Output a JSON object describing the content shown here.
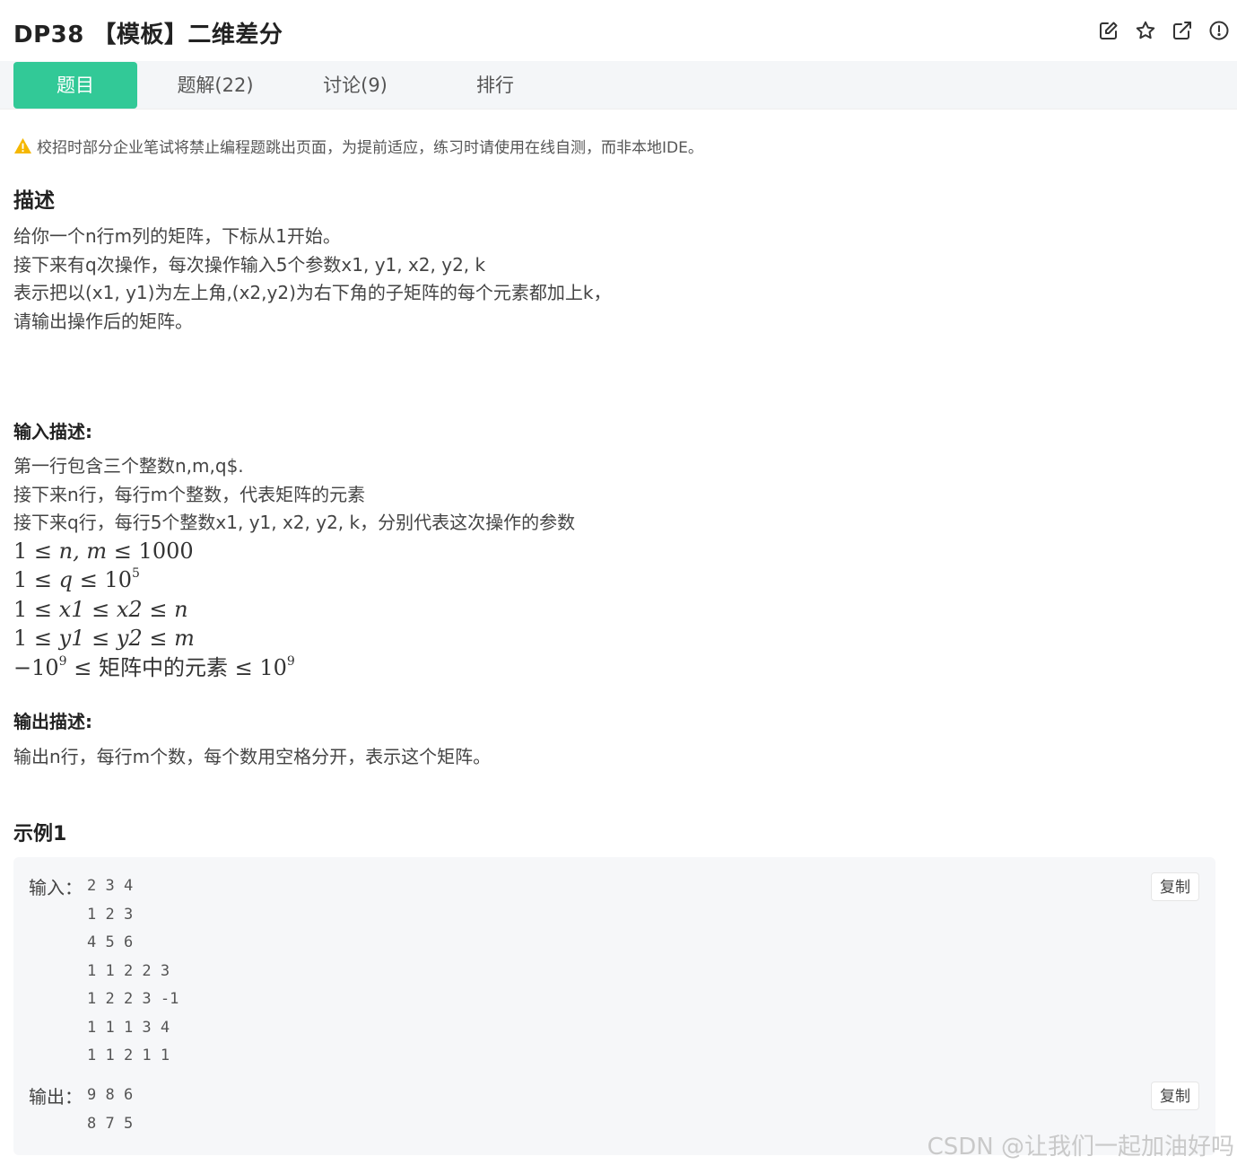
{
  "problem": {
    "title": "DP38 【模板】二维差分",
    "actions": [
      {
        "name": "edit-icon"
      },
      {
        "name": "star-icon"
      },
      {
        "name": "share-icon"
      },
      {
        "name": "report-icon"
      }
    ]
  },
  "tabs": [
    {
      "label": "题目",
      "active": true
    },
    {
      "label": "题解(22)",
      "active": false
    },
    {
      "label": "讨论(9)",
      "active": false
    },
    {
      "label": "排行",
      "active": false
    }
  ],
  "notice": {
    "icon": "warning-icon",
    "color": "#f5b700",
    "text": "校招时部分企业笔试将禁止编程题跳出页面，为提前适应，练习时请使用在线自测，而非本地IDE。"
  },
  "description": {
    "heading": "描述",
    "lines": [
      "给你一个n行m列的矩阵，下标从1开始。",
      "接下来有q次操作，每次操作输入5个参数x1, y1, x2, y2, k",
      "表示把以(x1, y1)为左上角,(x2,y2)为右下角的子矩阵的每个元素都加上k，",
      "请输出操作后的矩阵。"
    ]
  },
  "input_desc": {
    "heading": "输入描述:",
    "lines": [
      "第一行包含三个整数n,m,q$.",
      "接下来n行，每行m个整数，代表矩阵的元素",
      "接下来q行，每行5个整数x1, y1, x2, y2, k，分别代表这次操作的参数"
    ],
    "constraints": {
      "c1": {
        "lo": "1",
        "vars": "n, m",
        "hi": "1000"
      },
      "c2": {
        "lo": "1",
        "var": "q",
        "base": "10",
        "exp": "5"
      },
      "c3": {
        "lo": "1",
        "a": "x1",
        "b": "x2",
        "c": "n"
      },
      "c4": {
        "lo": "1",
        "a": "y1",
        "b": "y2",
        "c": "m"
      },
      "c5": {
        "neg_base": "−10",
        "neg_exp": "9",
        "mid": "矩阵中的元素",
        "base": "10",
        "exp": "9"
      }
    },
    "leq": "≤"
  },
  "output_desc": {
    "heading": "输出描述:",
    "lines": [
      "输出n行，每行m个数，每个数用空格分开，表示这个矩阵。"
    ]
  },
  "example": {
    "heading": "示例1",
    "input_label": "输入：",
    "input_lines": [
      "2 3 4",
      "1 2 3",
      "4 5 6",
      "1 1 2 2 3",
      "1 2 2 3 -1",
      "1 1 1 3 4",
      "1 1 2 1 1"
    ],
    "output_label": "输出：",
    "output_lines": [
      "9 8 6",
      "8 7 5"
    ],
    "copy_label": "复制"
  },
  "watermark": "CSDN @让我们一起加油好吗",
  "colors": {
    "accent": "#32c997",
    "tab_bg": "#f4f6f8",
    "sample_bg": "#f6f7f9"
  }
}
